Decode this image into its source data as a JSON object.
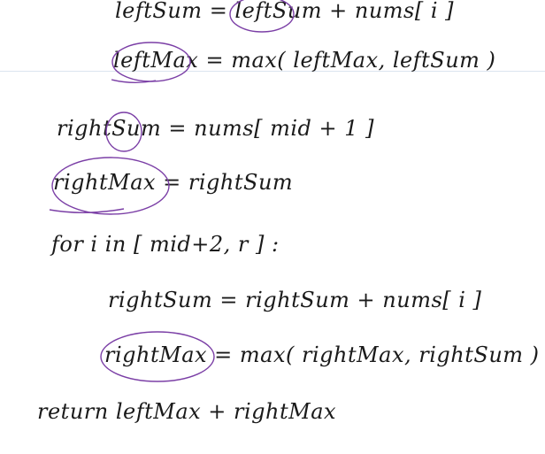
{
  "notes": {
    "lines": [
      "leftSum  =  leftSum  +  nums[ i ]",
      "leftMax  =  max( leftMax,  leftSum )",
      "rightSum  =  nums[ mid + 1 ]",
      "rightMax  =  rightSum",
      "for  i  in  [ mid+2,  r ] :",
      "rightSum  =  rightSum  +  nums[ i ]",
      "rightMax  =  max( rightMax,  rightSum )",
      "return   leftMax  +  rightMax"
    ]
  },
  "colors": {
    "ink": "#1a1a1a",
    "annotation": "#7b3fa6",
    "rule": "#dce4ef"
  }
}
